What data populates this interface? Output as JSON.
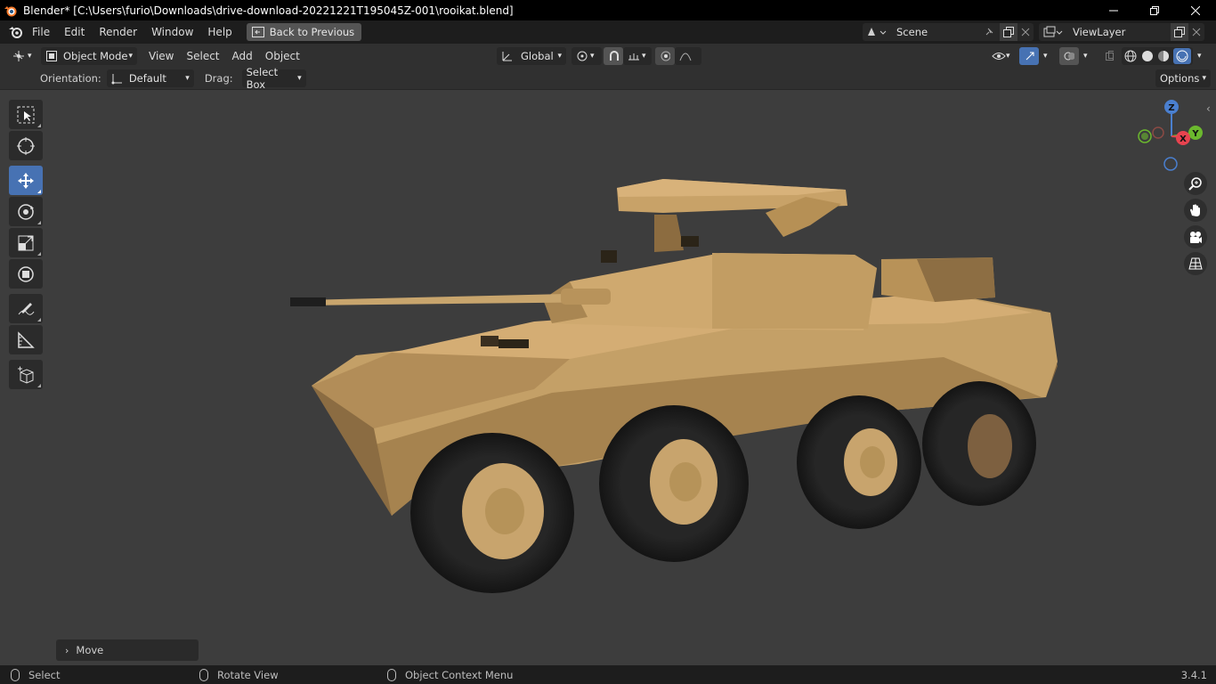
{
  "titlebar": {
    "title": "Blender* [C:\\Users\\furio\\Downloads\\drive-download-20221221T195045Z-001\\rooikat.blend]"
  },
  "topbar": {
    "menus": [
      "File",
      "Edit",
      "Render",
      "Window",
      "Help"
    ],
    "back_button": "Back to Previous",
    "scene_name": "Scene",
    "view_layer": "ViewLayer"
  },
  "viewport_header": {
    "mode": "Object Mode",
    "menus": [
      "View",
      "Select",
      "Add",
      "Object"
    ],
    "transform_orientation": "Global"
  },
  "tool_settings": {
    "orientation_label": "Orientation:",
    "orientation_value": "Default",
    "drag_label": "Drag:",
    "drag_value": "Select Box",
    "options_label": "Options"
  },
  "gizmo": {
    "z_label": "Z",
    "y_label": "Y",
    "x_label": "X"
  },
  "last_operator": {
    "label": "Move"
  },
  "statusbar": {
    "select": "Select",
    "rotate": "Rotate View",
    "context_menu": "Object Context Menu",
    "version": "3.4.1"
  },
  "colors": {
    "accent": "#4772b3",
    "viewport_bg": "#3d3d3d",
    "vehicle_body": "#c9a26b",
    "tire": "#1e1e1e",
    "axis_x": "#e8434f",
    "axis_y": "#6bb82e",
    "axis_z": "#4a7fcf"
  }
}
